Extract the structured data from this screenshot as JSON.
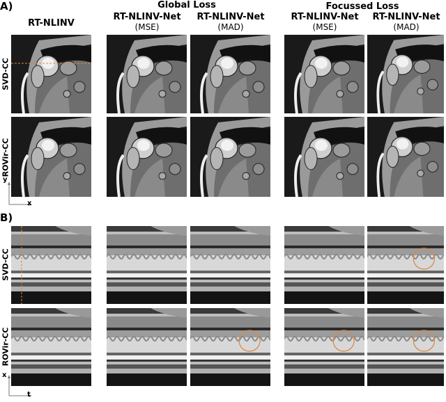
{
  "figure": {
    "section_a_label": "A)",
    "section_b_label": "B)",
    "groups": [
      {
        "title": "Global Loss"
      },
      {
        "title": "Focussed Loss"
      }
    ],
    "columns": [
      {
        "title": "RT-NLINV",
        "subtitle": ""
      },
      {
        "title": "RT-NLINV-Net",
        "subtitle": "(MSE)"
      },
      {
        "title": "RT-NLINV-Net",
        "subtitle": "(MAD)"
      },
      {
        "title": "RT-NLINV-Net",
        "subtitle": "(MSE)"
      },
      {
        "title": "RT-NLINV-Net",
        "subtitle": "(MAD)"
      }
    ],
    "rows": [
      {
        "label": "SVD-CC"
      },
      {
        "label": "ROVir-CC"
      }
    ],
    "axes_a": {
      "vertical": "y",
      "horizontal": "x"
    },
    "axes_b": {
      "vertical": "x",
      "horizontal": "t"
    },
    "highlight_color": "#d98a45",
    "circles_b": [
      {
        "row": 0,
        "col": 4
      },
      {
        "row": 1,
        "col": 2
      },
      {
        "row": 1,
        "col": 3
      },
      {
        "row": 1,
        "col": 4
      }
    ]
  }
}
